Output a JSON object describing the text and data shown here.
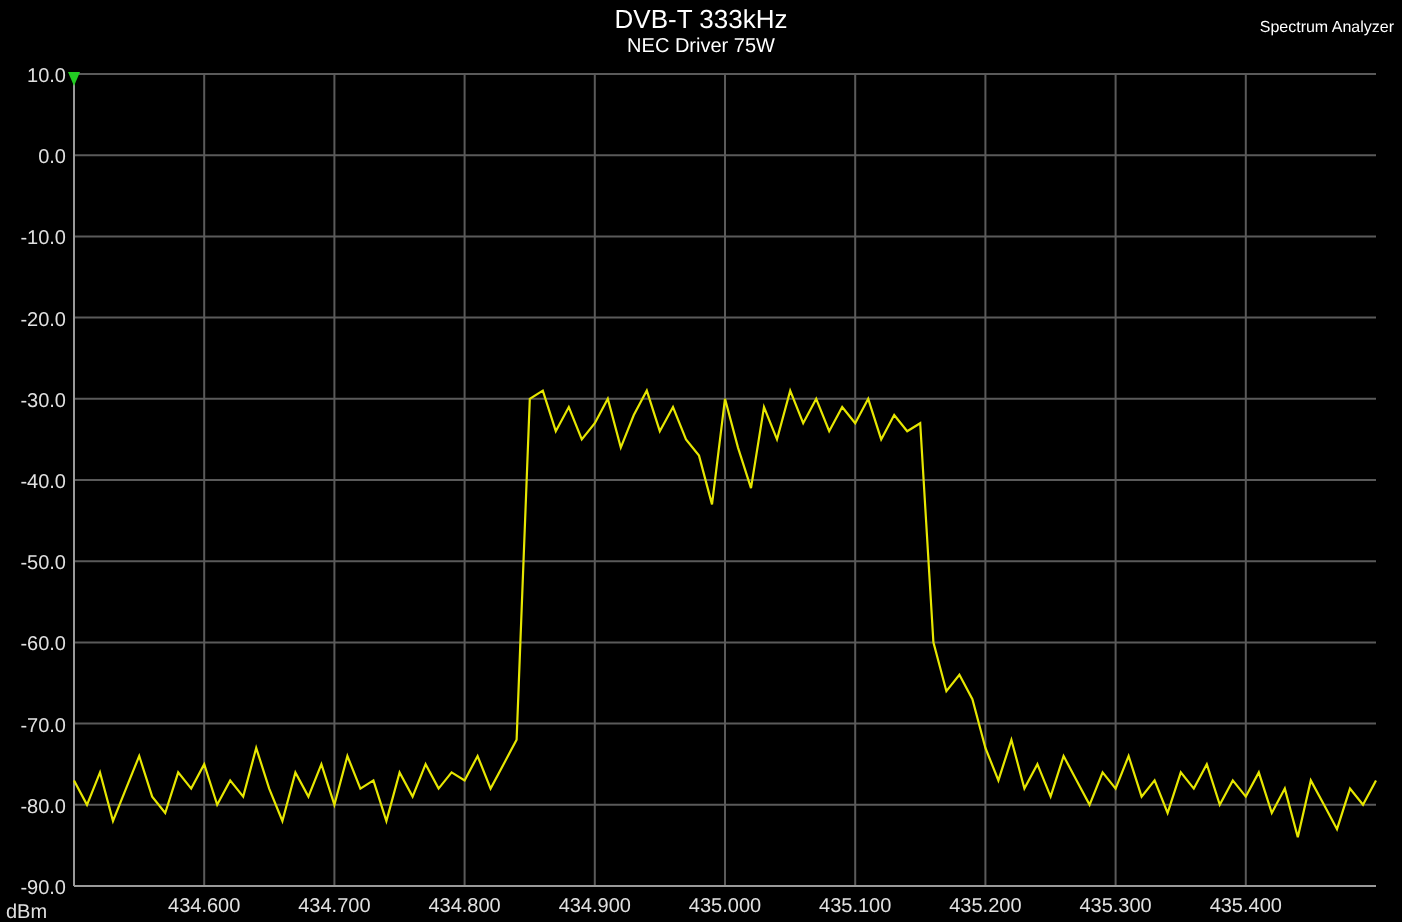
{
  "header": {
    "title": "DVB-T 333kHz",
    "subtitle": "NEC Driver 75W",
    "app_name": "Spectrum Analyzer"
  },
  "chart": {
    "chart_data": {
      "type": "line",
      "grid": true,
      "ylabel": "dBm",
      "xlim": [
        434.5,
        435.5
      ],
      "ylim": [
        -90,
        10
      ],
      "xticks": [
        {
          "value": 434.6,
          "label": "434.600"
        },
        {
          "value": 434.7,
          "label": "434.700"
        },
        {
          "value": 434.8,
          "label": "434.800"
        },
        {
          "value": 434.9,
          "label": "434.900"
        },
        {
          "value": 435.0,
          "label": "435.000"
        },
        {
          "value": 435.1,
          "label": "435.100"
        },
        {
          "value": 435.2,
          "label": "435.200"
        },
        {
          "value": 435.3,
          "label": "435.300"
        },
        {
          "value": 435.4,
          "label": "435.400"
        }
      ],
      "yticks": [
        {
          "value": 10,
          "label": "10.0"
        },
        {
          "value": 0,
          "label": "0.0"
        },
        {
          "value": -10,
          "label": "-10.0"
        },
        {
          "value": -20,
          "label": "-20.0"
        },
        {
          "value": -30,
          "label": "-30.0"
        },
        {
          "value": -40,
          "label": "-40.0"
        },
        {
          "value": -50,
          "label": "-50.0"
        },
        {
          "value": -60,
          "label": "-60.0"
        },
        {
          "value": -70,
          "label": "-70.0"
        },
        {
          "value": -80,
          "label": "-80.0"
        },
        {
          "value": -90,
          "label": "-90.0"
        }
      ],
      "x": [
        434.5,
        434.51,
        434.52,
        434.53,
        434.54,
        434.55,
        434.56,
        434.57,
        434.58,
        434.59,
        434.6,
        434.61,
        434.62,
        434.63,
        434.64,
        434.65,
        434.66,
        434.67,
        434.68,
        434.69,
        434.7,
        434.71,
        434.72,
        434.73,
        434.74,
        434.75,
        434.76,
        434.77,
        434.78,
        434.79,
        434.8,
        434.81,
        434.82,
        434.83,
        434.84,
        434.85,
        434.86,
        434.87,
        434.88,
        434.89,
        434.9,
        434.91,
        434.92,
        434.93,
        434.94,
        434.95,
        434.96,
        434.97,
        434.98,
        434.99,
        435.0,
        435.01,
        435.02,
        435.03,
        435.04,
        435.05,
        435.06,
        435.07,
        435.08,
        435.09,
        435.1,
        435.11,
        435.12,
        435.13,
        435.14,
        435.15,
        435.16,
        435.17,
        435.18,
        435.19,
        435.2,
        435.21,
        435.22,
        435.23,
        435.24,
        435.25,
        435.26,
        435.27,
        435.28,
        435.29,
        435.3,
        435.31,
        435.32,
        435.33,
        435.34,
        435.35,
        435.36,
        435.37,
        435.38,
        435.39,
        435.4,
        435.41,
        435.42,
        435.43,
        435.44,
        435.45,
        435.46,
        435.47,
        435.48,
        435.49,
        435.5
      ],
      "series": [
        {
          "color": "#e6e600",
          "values": [
            -77,
            -80,
            -76,
            -82,
            -78,
            -74,
            -79,
            -81,
            -76,
            -78,
            -75,
            -80,
            -77,
            -79,
            -73,
            -78,
            -82,
            -76,
            -79,
            -75,
            -80,
            -74,
            -78,
            -77,
            -82,
            -76,
            -79,
            -75,
            -78,
            -76,
            -77,
            -74,
            -78,
            -75,
            -72,
            -30,
            -29,
            -34,
            -31,
            -35,
            -33,
            -30,
            -36,
            -32,
            -29,
            -34,
            -31,
            -35,
            -37,
            -43,
            -30,
            -36,
            -41,
            -31,
            -35,
            -29,
            -33,
            -30,
            -34,
            -31,
            -33,
            -30,
            -35,
            -32,
            -34,
            -33,
            -60,
            -66,
            -64,
            -67,
            -73,
            -77,
            -72,
            -78,
            -75,
            -79,
            -74,
            -77,
            -80,
            -76,
            -78,
            -74,
            -79,
            -77,
            -81,
            -76,
            -78,
            -75,
            -80,
            -77,
            -79,
            -76,
            -81,
            -78,
            -84,
            -77,
            -80,
            -83,
            -78,
            -80,
            -77
          ]
        }
      ]
    }
  }
}
